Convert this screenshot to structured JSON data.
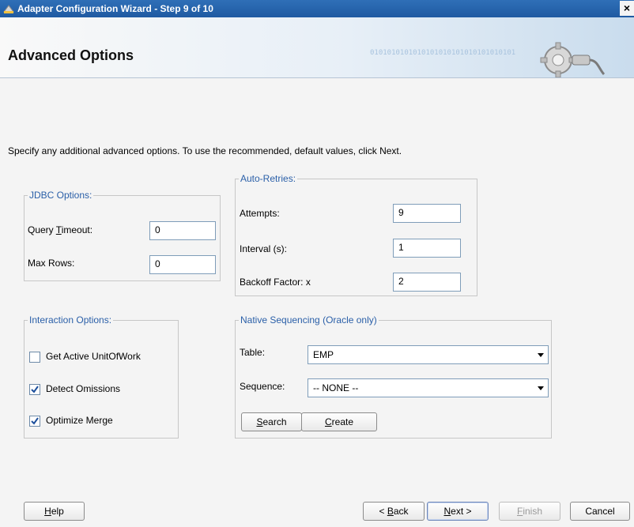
{
  "window": {
    "title": "Adapter Configuration Wizard - Step 9 of 10",
    "close_glyph": "×"
  },
  "banner": {
    "title": "Advanced Options",
    "binary_text": "0101010101010101010101010101010101"
  },
  "intro": "Specify any additional advanced options.  To use the recommended, default values, click Next.",
  "jdbc": {
    "legend": "JDBC Options:",
    "query_timeout": {
      "label_pre": "Query ",
      "label_mn": "T",
      "label_post": "imeout:",
      "value": "0"
    },
    "max_rows": {
      "label": "Max Rows:",
      "value": "0"
    }
  },
  "retries": {
    "legend": "Auto-Retries:",
    "attempts": {
      "label": "Attempts:",
      "value": "9"
    },
    "interval": {
      "label": "Interval (s):",
      "value": "1"
    },
    "backoff": {
      "label": "Backoff Factor: x",
      "value": "2"
    }
  },
  "interaction": {
    "legend": "Interaction Options:",
    "options": [
      {
        "label": "Get Active UnitOfWork",
        "checked": false
      },
      {
        "label": "Detect Omissions",
        "checked": true
      },
      {
        "label": "Optimize Merge",
        "checked": true
      }
    ]
  },
  "sequencing": {
    "legend": "Native Sequencing (Oracle only)",
    "table": {
      "label": "Table:",
      "value": "EMP"
    },
    "sequence": {
      "label": "Sequence:",
      "value": "-- NONE --"
    },
    "search": {
      "mn": "S",
      "rest": "earch"
    },
    "create": {
      "mn": "C",
      "rest": "reate"
    }
  },
  "footer": {
    "help": {
      "mn": "H",
      "rest": "elp"
    },
    "back": {
      "pre": "< ",
      "mn": "B",
      "rest": "ack"
    },
    "next": {
      "mn": "N",
      "rest": "ext >"
    },
    "finish": {
      "mn": "F",
      "rest": "inish"
    },
    "cancel": "Cancel"
  },
  "colors": {
    "title_bar": "#1f5aa2",
    "group_legend": "#2a5fa8",
    "check": "#1c4f9c"
  },
  "icons": [
    "wizard-app-icon",
    "close-icon",
    "gear-plug-icon",
    "checkmark-icon",
    "dropdown-arrow-icon"
  ]
}
